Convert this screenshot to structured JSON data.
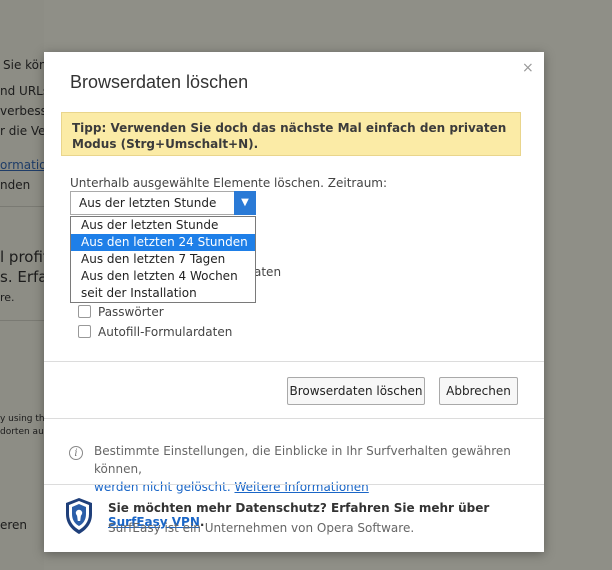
{
  "background": {
    "lines": [
      "Sie könn",
      "nd URLs",
      "verbesser",
      "r die Ver",
      "ormatione",
      "nden"
    ],
    "big_lines": [
      "l profitie",
      "s. Erfah"
    ],
    "small_line": "re.",
    "tiny_lines": [
      "y using th",
      "dorten auf"
    ],
    "bottom_line": "eren"
  },
  "dialog": {
    "title": "Browserdaten löschen",
    "close": "×",
    "tip": "Tipp: Verwenden Sie doch das nächste Mal einfach den privaten Modus (Strg+Umschalt+N).",
    "range_label": "Unterhalb ausgewählte Elemente löschen. Zeitraum:",
    "select_value": "Aus der letzten Stunde",
    "options": [
      "Aus der letzten Stunde",
      "Aus den letzten 24 Stunden",
      "Aus den letzten 7 Tagen",
      "Aus den letzten 4 Wochen",
      "seit der Installation"
    ],
    "partial_hidden": "aten",
    "checkboxes": [
      "Passwörter",
      "Autofill-Formulardaten"
    ],
    "buttons": {
      "clear": "Browserdaten löschen",
      "cancel": "Abbrechen"
    },
    "info": {
      "text": "Bestimmte Einstellungen, die Einblicke in Ihr Surfverhalten gewähren können,",
      "link1": "werden nicht gelöscht.",
      "link2": "Weitere Informationen"
    },
    "promo": {
      "text": "Sie möchten mehr Datenschutz? Erfahren Sie mehr über",
      "link": "SurfEasy VPN",
      "period": ".",
      "subtext": "SurfEasy ist ein Unternehmen von Opera Software."
    }
  },
  "colors": {
    "accent": "#1e7fe8",
    "tip_bg": "#fbeba6",
    "link": "#1a66c7"
  }
}
